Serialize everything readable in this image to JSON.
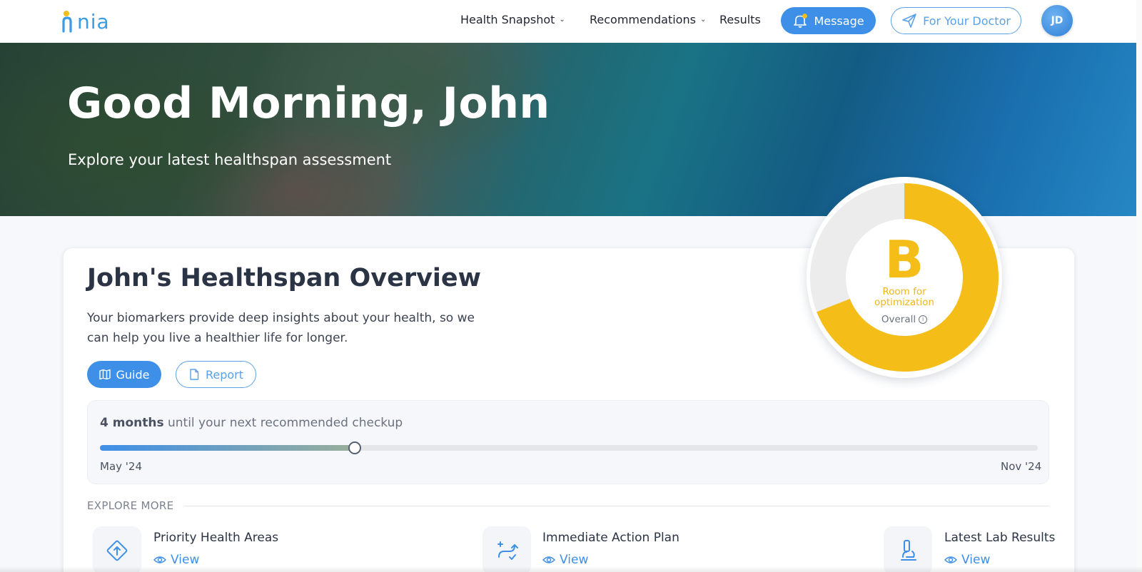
{
  "brand": {
    "logo_text": "nia",
    "accent_color": "#3e8fe8",
    "grade_color": "#f4bd18"
  },
  "nav": {
    "items": [
      {
        "label": "Health Snapshot",
        "has_dropdown": true
      },
      {
        "label": "Recommendations",
        "has_dropdown": true
      },
      {
        "label": "Results",
        "has_dropdown": false
      }
    ],
    "message_label": "Message",
    "doctor_label": "For Your Doctor",
    "avatar_initials": "JD",
    "icons": {
      "message": "bell-icon",
      "doctor": "send-icon"
    }
  },
  "hero": {
    "greeting": "Good Morning, John",
    "subtitle": "Explore your latest healthspan assessment"
  },
  "overview": {
    "title": "John's Healthspan Overview",
    "description": "Your biomarkers provide deep insights about your health, so we can help you live a healthier life for longer.",
    "guide_label": "Guide",
    "report_label": "Report",
    "icons": {
      "guide": "map-icon",
      "report": "document-icon"
    }
  },
  "score": {
    "grade": "B",
    "description": "Room for optimization",
    "overall_label": "Overall",
    "fill_fraction": 0.69
  },
  "checkup": {
    "months_bold": "4 months",
    "rest_text": " until your next recommended checkup",
    "start_label": "May '24",
    "end_label": "Nov '24",
    "progress_fraction": 0.272
  },
  "explore": {
    "label": "EXPLORE MORE",
    "tiles": [
      {
        "title": "Priority Health Areas",
        "view_label": "View",
        "icon": "priority-diamond-icon"
      },
      {
        "title": "Immediate Action Plan",
        "view_label": "View",
        "icon": "route-icon"
      },
      {
        "title": "Latest Lab Results",
        "view_label": "View",
        "icon": "microscope-icon"
      }
    ]
  }
}
